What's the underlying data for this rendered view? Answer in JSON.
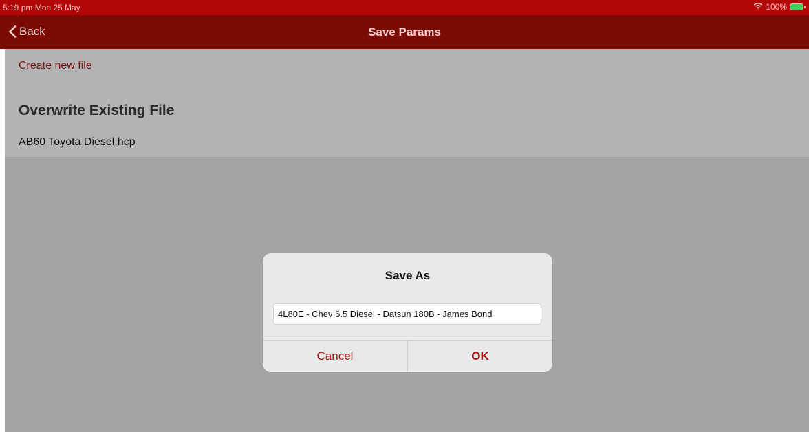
{
  "status_bar": {
    "time_date": "5:19 pm  Mon 25 May",
    "battery_percent": "100%",
    "wifi_icon": "wifi-icon",
    "battery_icon": "battery-charging-icon"
  },
  "nav": {
    "back_label": "Back",
    "back_icon": "chevron-left-icon",
    "title": "Save Params"
  },
  "list": {
    "create_new_label": "Create new file",
    "section_heading": "Overwrite Existing File",
    "files": [
      "AB60 Toyota Diesel.hcp"
    ]
  },
  "dialog": {
    "title": "Save As",
    "input_value": "4L80E - Chev 6.5 Diesel - Datsun 180B - James Bond",
    "cancel_label": "Cancel",
    "ok_label": "OK"
  },
  "colors": {
    "status_bar": "#b30606",
    "nav_bar": "#7b0b03",
    "accent": "#a71414",
    "battery_fill": "#3ed15a"
  }
}
